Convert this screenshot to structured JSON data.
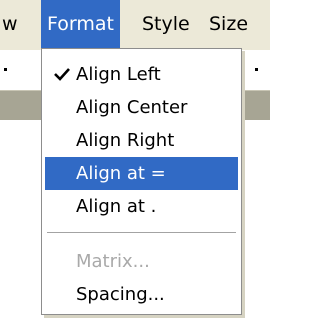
{
  "menubar": {
    "items": [
      {
        "label": "w"
      },
      {
        "label": "Format",
        "active": true
      },
      {
        "label": "Style"
      },
      {
        "label": "Size"
      }
    ]
  },
  "format_menu": {
    "items": [
      {
        "label": "Align Left",
        "checked": true
      },
      {
        "label": "Align Center"
      },
      {
        "label": "Align Right"
      },
      {
        "label": "Align at =",
        "highlighted": true
      },
      {
        "label": "Align at ."
      },
      {
        "label": "Matrix...",
        "disabled": true
      },
      {
        "label": "Spacing..."
      }
    ]
  },
  "icons": {
    "checkmark": "check-icon"
  },
  "colors": {
    "highlight": "#316ac5",
    "menubar_bg": "#ece9d8",
    "disabled_text": "#a9a9a9"
  }
}
